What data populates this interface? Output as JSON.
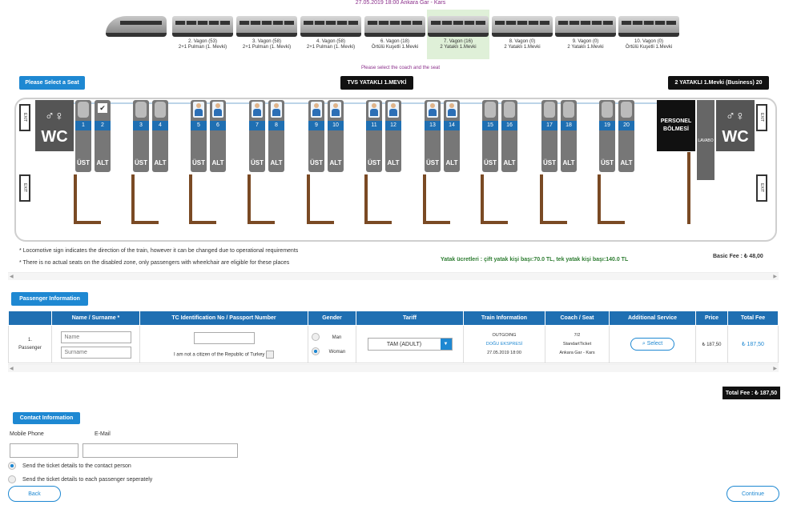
{
  "header": {
    "route_title": "27.05.2019 18:00 Ankara Gar - Kars",
    "coach_notice": "Please select the coach and the seat"
  },
  "wagons": [
    {
      "line1": "2. Vagon (53)",
      "line2": "2+1 Pulman (1. Mevki)",
      "selected": false
    },
    {
      "line1": "3. Vagon (58)",
      "line2": "2+1 Pulman (1. Mevki)",
      "selected": false
    },
    {
      "line1": "4. Vagon (58)",
      "line2": "2+1 Pulman (1. Mevki)",
      "selected": false
    },
    {
      "line1": "6. Vagon (18)",
      "line2": "Örtülü Kuşetli 1.Mevki",
      "selected": false
    },
    {
      "line1": "7. Vagon (16)",
      "line2": "2 Yataklı 1.Mevki",
      "selected": true
    },
    {
      "line1": "8. Vagon (0)",
      "line2": "2 Yataklı 1.Mevki",
      "selected": false
    },
    {
      "line1": "9. Vagon (0)",
      "line2": "2 Yataklı 1.Mevki",
      "selected": false
    },
    {
      "line1": "10. Vagon (0)",
      "line2": "Örtülü Kuşetli 1.Mevki",
      "selected": false
    }
  ],
  "bars": {
    "select_seat": "Please Select a Seat",
    "coach_type": "TVS YATAKLI 1.MEVKİ",
    "coach_class": "2 YATAKLI 1.Mevki (Business) 20"
  },
  "coach": {
    "wc_label": "WC",
    "exit_label": "EXIT",
    "personel_line1": "PERSONEL",
    "personel_line2": "BÖLMESİ",
    "lavabo": "LAVABO",
    "ust": "ÜST",
    "alt": "ALT",
    "seats": [
      {
        "n": "1",
        "state": "free"
      },
      {
        "n": "2",
        "state": "checked"
      },
      {
        "n": "3",
        "state": "free"
      },
      {
        "n": "4",
        "state": "free"
      },
      {
        "n": "5",
        "state": "occupied"
      },
      {
        "n": "6",
        "state": "occupied"
      },
      {
        "n": "7",
        "state": "occupied"
      },
      {
        "n": "8",
        "state": "occupied"
      },
      {
        "n": "9",
        "state": "occupied"
      },
      {
        "n": "10",
        "state": "occupied"
      },
      {
        "n": "11",
        "state": "occupied"
      },
      {
        "n": "12",
        "state": "occupied"
      },
      {
        "n": "13",
        "state": "occupied"
      },
      {
        "n": "14",
        "state": "occupied"
      },
      {
        "n": "15",
        "state": "free"
      },
      {
        "n": "16",
        "state": "free"
      },
      {
        "n": "17",
        "state": "free"
      },
      {
        "n": "18",
        "state": "free"
      },
      {
        "n": "19",
        "state": "free"
      },
      {
        "n": "20",
        "state": "free"
      }
    ]
  },
  "notes": {
    "n1": "* Locomotive sign indicates the direction of the train, however it can be changed due to operational requirements",
    "n2": "* There is no actual seats on the disabled zone, only passengers with wheelchair are eligible for these places",
    "fees_green": "Yatak ücretleri : çift yatak kişi başı:70.0 TL, tek yatak kişi başı:140.0 TL",
    "basic_fee": "Basic Fee : ₺ 48,00"
  },
  "passenger": {
    "section_title": "Passenger Information",
    "headers": [
      "Name / Surname *",
      "TC Identification No / Passport Number",
      "Gender",
      "Tariff",
      "Train Information",
      "Coach / Seat",
      "Additional Service",
      "Price",
      "Total Fee"
    ],
    "row_label_1": "1.",
    "row_label_2": "Passenger",
    "name_placeholder": "Name",
    "surname_placeholder": "Surname",
    "citizen_text": "I am not a citizen of the Republic of Turkey",
    "gender_man": "Man",
    "gender_woman": "Woman",
    "tariff": "TAM (ADULT)",
    "train_dir": "OUTGOING",
    "train_name": "DOĞU EKSPRESİ",
    "train_date": "27.05.2019 18:00",
    "coach_seat": "7/2",
    "ticket_type": "StandartTicket",
    "route": "Ankara Gar - Kars",
    "service_btn": "Select",
    "price": "₺ 187,50",
    "total": "₺ 187,50"
  },
  "total_fee": "Total Fee : ₺ 187,50",
  "contact": {
    "section_title": "Contact Information",
    "mobile_label": "Mobile Phone",
    "email_label": "E-Mail",
    "opt1": "Send the ticket details to the contact person",
    "opt2": "Send the ticket details to each passenger seperately"
  },
  "nav": {
    "back": "Back",
    "continue": "Continue"
  },
  "colors": {
    "accent": "#1e88d2",
    "seat_number": "#1f6fb2",
    "compartment": "#7a4a24",
    "green_text": "#2e7d32"
  }
}
